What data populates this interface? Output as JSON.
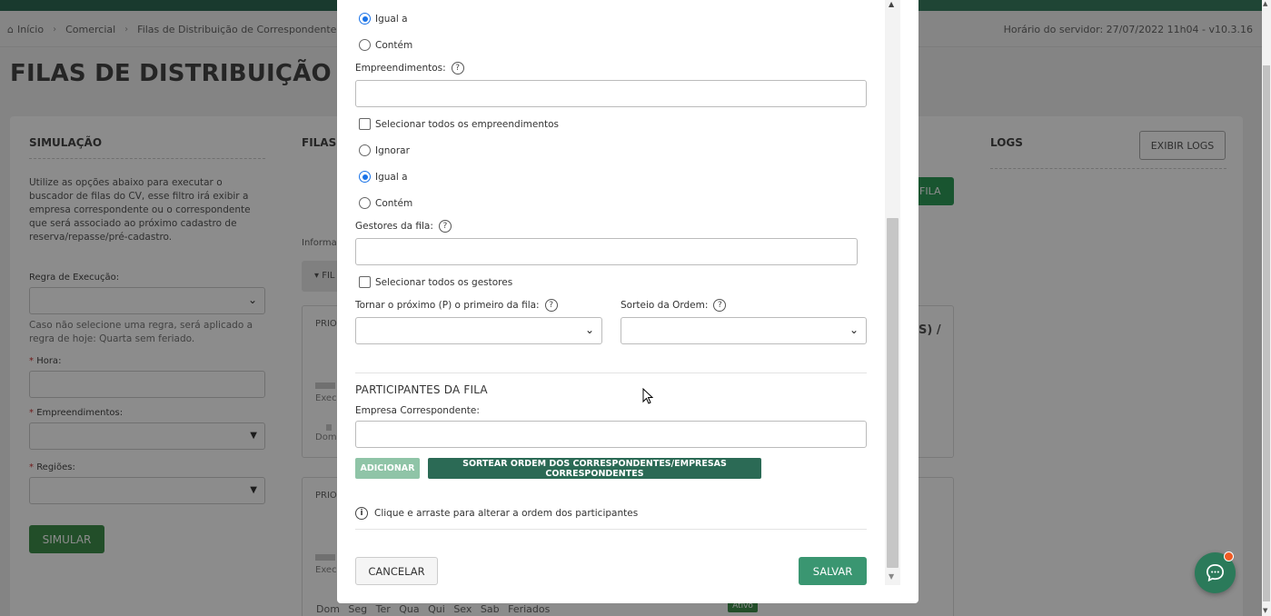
{
  "breadcrumb": {
    "home": "Início",
    "level1": "Comercial",
    "level2": "Filas de Distribuição de Correspondentes",
    "home_icon": "home-icon",
    "separator_icon": "chevron-right-icon"
  },
  "server_time": "Horário do servidor: 27/07/2022 11h04 - v10.3.16",
  "page_title": "FILAS DE DISTRIBUIÇÃO DE CO",
  "simulation": {
    "title": "SIMULAÇÃO",
    "description": "Utilize as opções abaixo para executar o buscador de filas do CV, esse filtro irá exibir a empresa correspondente ou o correspondente que será associado ao próximo cadastro de reserva/repasse/pré-cadastro.",
    "rule_label": "Regra de Execução:",
    "rule_hint": "Caso não selecione uma regra, será aplicado a regra de hoje: Quarta sem feriado.",
    "hour_label": "Hora:",
    "developments_label": "Empreendimentos:",
    "regions_label": "Regiões:",
    "simulate_button": "SIMULAR"
  },
  "filas": {
    "title": "FILAS",
    "info_partial": "Informaç",
    "filter_partial": "FIL",
    "priority_partial": "PRIO",
    "exec_partial": "Exec",
    "dom_partial": "Dom",
    "days": "Dom Seg Ter Qua Qui Sex Sab Feriados",
    "active_badge": "Ativo",
    "new_queue_partial": "FILA",
    "s_partial": "S) /"
  },
  "logs": {
    "title": "LOGS",
    "show_logs_button": "EXIBIR LOGS"
  },
  "modal": {
    "radio_top_equal": "Igual a",
    "radio_top_contains": "Contém",
    "developments_label": "Empreendimentos:",
    "select_all_developments": "Selecionar todos os empreendimentos",
    "radio_ignore": "Ignorar",
    "radio_equal": "Igual a",
    "radio_contains": "Contém",
    "managers_label": "Gestores da fila:",
    "select_all_managers": "Selecionar todos os gestores",
    "next_first_label": "Tornar o próximo (P) o primeiro da fila:",
    "draw_order_label": "Sorteio da Ordem:",
    "participants_title": "PARTICIPANTES DA FILA",
    "company_label": "Empresa Correspondente:",
    "add_button": "ADICIONAR",
    "shuffle_button": "SORTEAR ORDEM DOS CORRESPONDENTES/EMPRESAS CORRESPONDENTES",
    "drag_info": "Clique e arraste para alterar a ordem dos participantes",
    "cancel_button": "CANCELAR",
    "save_button": "SALVAR",
    "help_glyph": "?",
    "info_glyph": "i"
  },
  "colors": {
    "primary_green": "#3a9671",
    "dark_green": "#2b6a55",
    "light_green": "#8fc4a7",
    "radio_blue": "#1a73e8",
    "chat_badge": "#ef5b24"
  }
}
